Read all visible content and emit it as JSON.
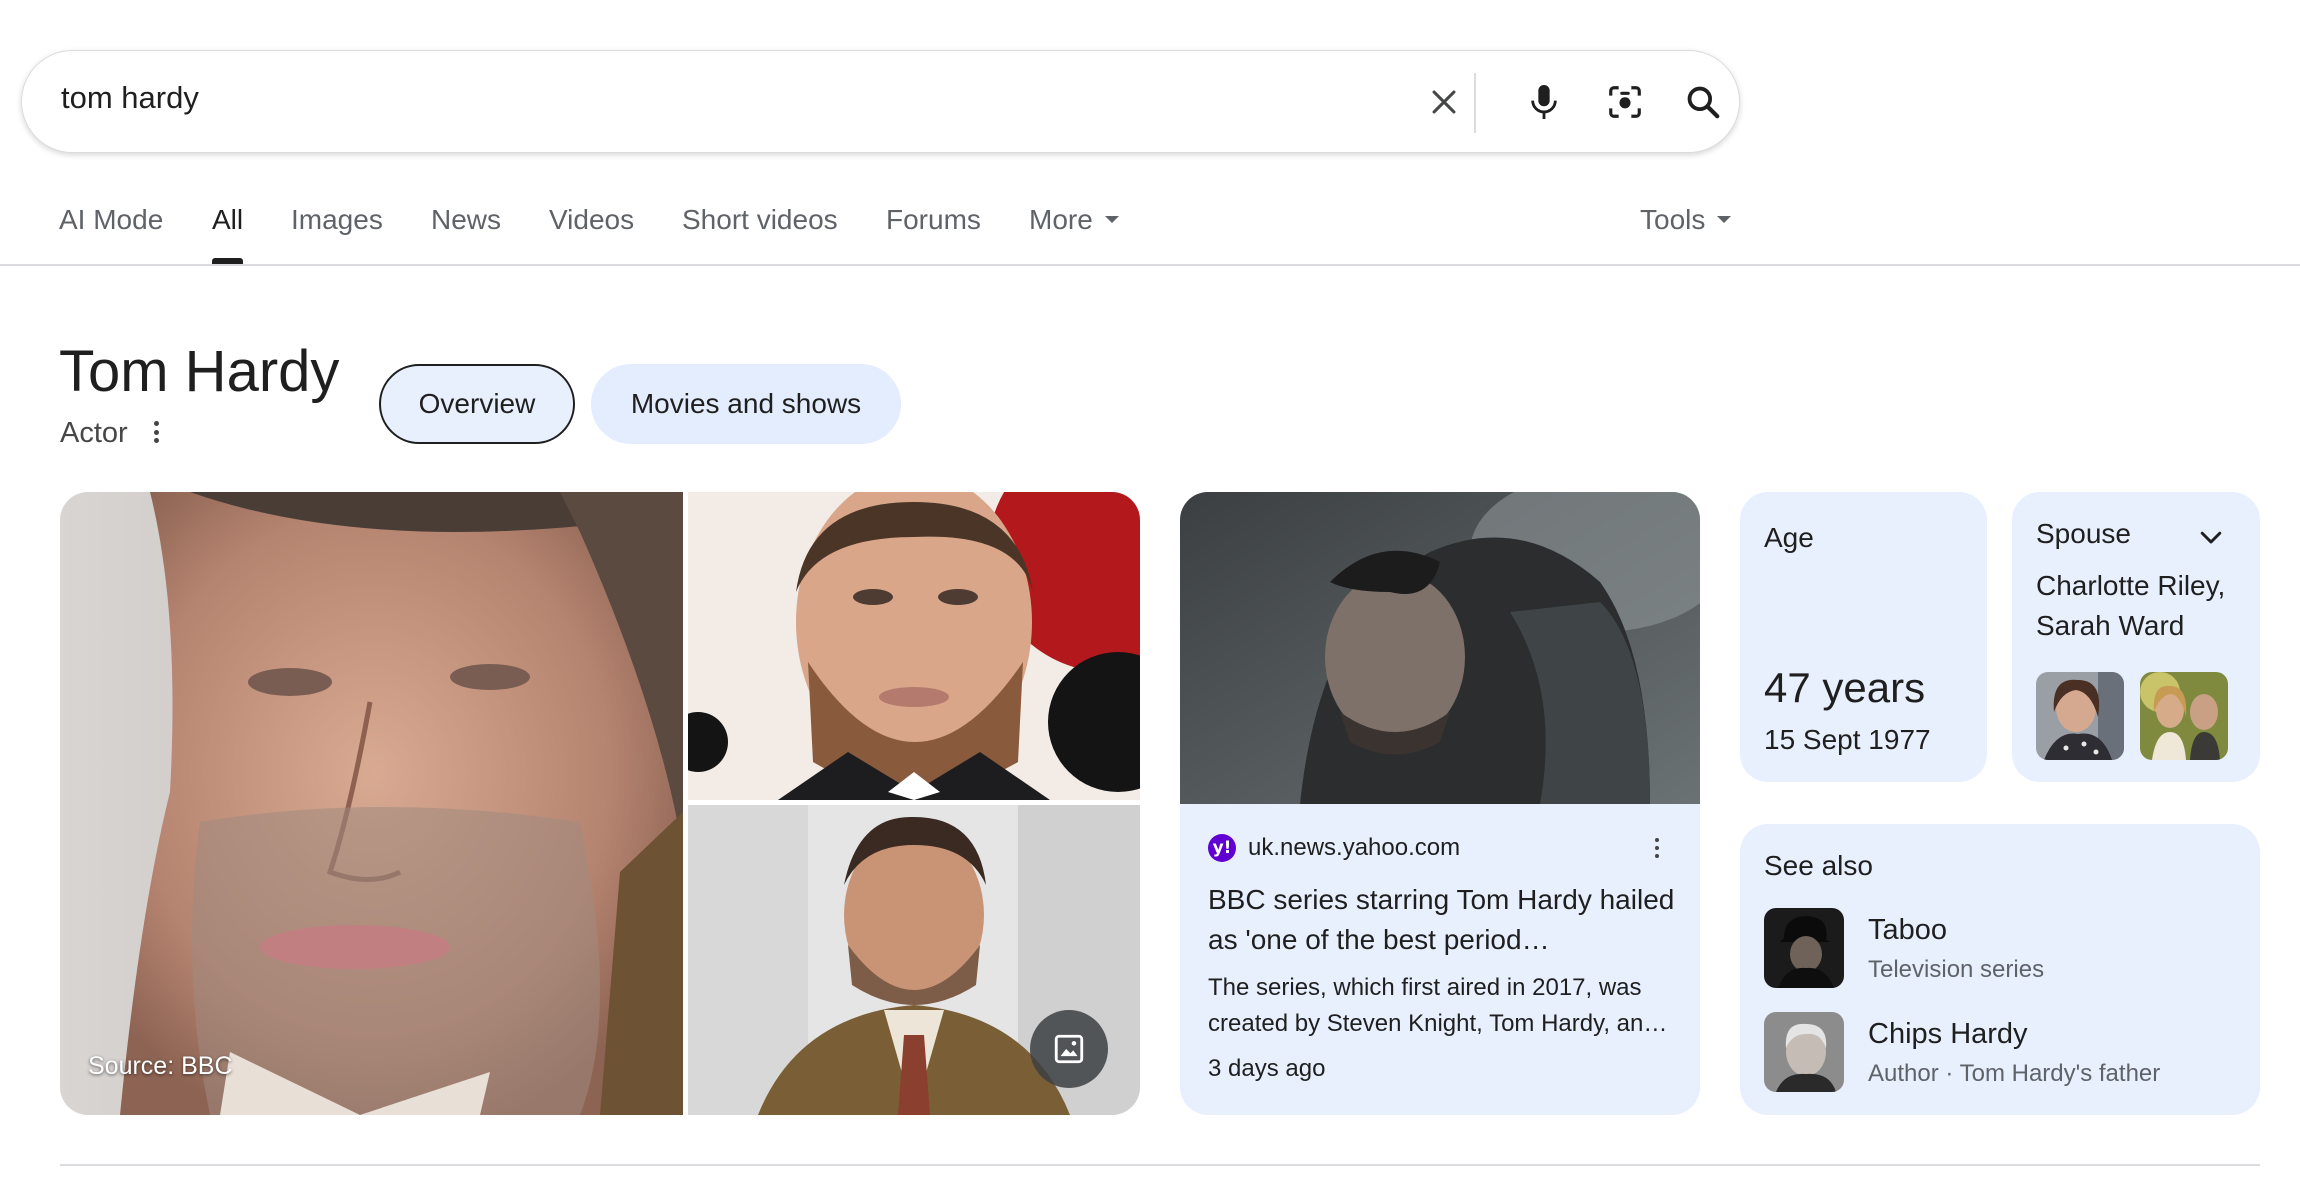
{
  "search": {
    "query": "tom hardy",
    "icons": [
      "close-icon",
      "mic-icon",
      "lens-icon",
      "search-icon"
    ]
  },
  "tabs": [
    {
      "label": "AI Mode",
      "active": false
    },
    {
      "label": "All",
      "active": true
    },
    {
      "label": "Images",
      "active": false
    },
    {
      "label": "News",
      "active": false
    },
    {
      "label": "Videos",
      "active": false
    },
    {
      "label": "Short videos",
      "active": false
    },
    {
      "label": "Forums",
      "active": false
    },
    {
      "label": "More",
      "active": false
    }
  ],
  "tools_label": "Tools",
  "entity": {
    "name": "Tom Hardy",
    "subtitle": "Actor",
    "chips": [
      "Overview",
      "Movies and shows"
    ]
  },
  "images": {
    "source_label": "Source: BBC"
  },
  "news": {
    "domain": "uk.news.yahoo.com",
    "badge": "y!",
    "title": "BBC series starring Tom Hardy hailed as 'one of the best period…",
    "snippet": "The series, which first aired in 2017, was created by Steven Knight, Tom Hardy, an…",
    "time": "3 days ago"
  },
  "age": {
    "label": "Age",
    "value": "47 years",
    "date": "15 Sept 1977"
  },
  "spouse": {
    "label": "Spouse",
    "names": "Charlotte Riley, Sarah Ward"
  },
  "see_also": {
    "label": "See also",
    "items": [
      {
        "name": "Taboo",
        "desc": "Television series"
      },
      {
        "name": "Chips Hardy",
        "desc": "Author · Tom Hardy's father"
      }
    ]
  },
  "colors": {
    "card_bg": "#e8f0fe",
    "chip_bg": "#e3edfd",
    "yahoo": "#6001d2",
    "muted_text": "#5f6368"
  }
}
